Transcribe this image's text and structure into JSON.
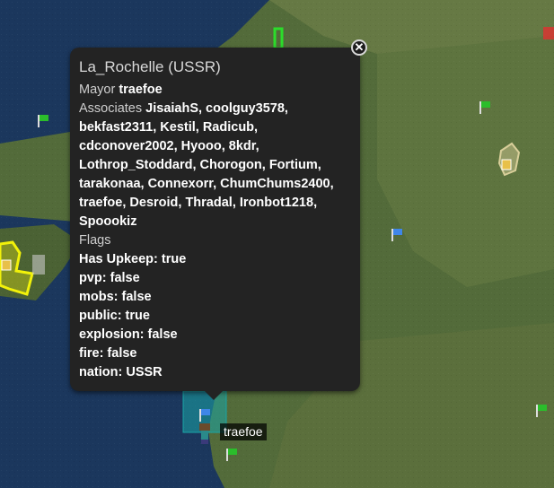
{
  "popup": {
    "town": "La_Rochelle (USSR)",
    "mayor_label": "Mayor",
    "mayor": "traefoe",
    "associates_label": "Associates",
    "associates_lines": [
      "JisaiahS, coolguy3578,",
      "bekfast2311, Kestil, Radicub,",
      "cdconover2002, Hyooo, 8kdr,",
      "Lothrop_Stoddard, Chorogon, Fortium,",
      "tarakonaa, Connexorr, ChumChums2400,",
      "traefoe, Desroid, Thradal, Ironbot1218,",
      "Spoookiz"
    ],
    "flags_label": "Flags",
    "flags": [
      "Has Upkeep: true",
      "pvp: false",
      "mobs: false",
      "public: true",
      "explosion: false",
      "fire: false",
      "nation: USSR"
    ],
    "close_icon": "close-icon"
  },
  "player_marker": {
    "name": "traefoe"
  },
  "colors": {
    "sea": "#1f3f6a",
    "land": "#5f7a43",
    "popup_bg": "#232323",
    "town_yellow": "#f2f20a",
    "town_beige": "#d9cf9a",
    "town_cyan": "#1aa6a6",
    "flag_green": "#2bbd2b",
    "flag_blue": "#3f86e8",
    "flag_red": "#e03131"
  }
}
